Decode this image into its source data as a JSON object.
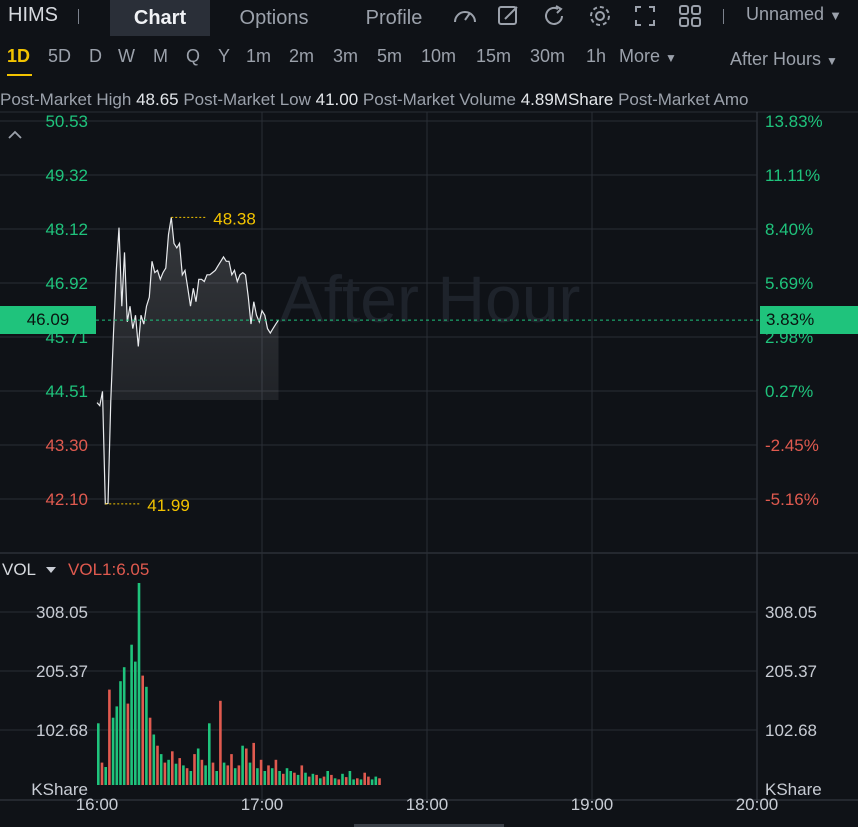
{
  "header": {
    "ticker": "HIMS",
    "tabs": [
      {
        "label": "Chart",
        "active": true
      },
      {
        "label": "Options",
        "active": false
      },
      {
        "label": "Profile",
        "active": false
      }
    ],
    "tool_icons": [
      "gauge-icon",
      "draw-icon",
      "refresh-icon",
      "settings-icon",
      "fullscreen-icon",
      "layout-grid-icon"
    ],
    "layout_name": "Unnamed"
  },
  "intervals": {
    "items": [
      "1D",
      "5D",
      "D",
      "W",
      "M",
      "Q",
      "Y",
      "1m",
      "2m",
      "3m",
      "5m",
      "10m",
      "15m",
      "30m",
      "1h"
    ],
    "active": "1D",
    "more_label": "More",
    "session_label": "After Hours"
  },
  "stats": {
    "high_label": "Post-Market High",
    "high_value": "48.65",
    "low_label": "Post-Market Low",
    "low_value": "41.00",
    "volume_label": "Post-Market Volume",
    "volume_value": "4.89MShare",
    "amount_label": "Post-Market Amo"
  },
  "colors": {
    "up": "#1fc37c",
    "down": "#e05a4f",
    "marker": "#f2c300",
    "line": "#e8eaed",
    "grid": "#2a2e36"
  },
  "chart_data": {
    "type": "line",
    "watermark": "After Hour",
    "x_tick_labels": [
      "16:00",
      "17:00",
      "18:00",
      "19:00",
      "20:00"
    ],
    "price_ticks": [
      "50.53",
      "49.32",
      "48.12",
      "46.92",
      "45.71",
      "44.51",
      "43.30",
      "42.10"
    ],
    "percent_ticks": [
      "13.83%",
      "11.11%",
      "8.40%",
      "5.69%",
      "2.98%",
      "0.27%",
      "-2.45%",
      "-5.16%"
    ],
    "ylim": [
      42.1,
      50.53
    ],
    "reference_price": 44.39,
    "current_price": "46.09",
    "current_percent": "3.83%",
    "high_marker": "48.38",
    "low_marker": "41.99",
    "series": [
      {
        "x_minutes": [
          0,
          1,
          2,
          3,
          4,
          5,
          6,
          7,
          8,
          9,
          10,
          11,
          12,
          13,
          14,
          15,
          16,
          17,
          18,
          19,
          20,
          21,
          22,
          23,
          24,
          25,
          26,
          27,
          28,
          29,
          30,
          31,
          32,
          33,
          34,
          35,
          36,
          37,
          38,
          39,
          40,
          41,
          42,
          43,
          44,
          45,
          46,
          47,
          48,
          49,
          50,
          51,
          52,
          53,
          54,
          55,
          56,
          57,
          58,
          59,
          60,
          61,
          62,
          63,
          64,
          65,
          66,
          67,
          68,
          69,
          70,
          71,
          72,
          73,
          74,
          75,
          76,
          77,
          78,
          79,
          80,
          81,
          82,
          83,
          84,
          85,
          86,
          87,
          88,
          89,
          90,
          91,
          92,
          93,
          94,
          95,
          96,
          97,
          98,
          99,
          100,
          101,
          102
        ],
        "values": [
          44.25,
          44.18,
          44.5,
          41.99,
          42.0,
          44.3,
          45.8,
          47.2,
          48.15,
          46.4,
          47.6,
          46.05,
          46.4,
          45.9,
          46.2,
          45.5,
          46.2,
          46.0,
          46.4,
          46.6,
          47.4,
          47.15,
          47.2,
          47.0,
          47.15,
          47.25,
          48.0,
          48.38,
          47.8,
          47.7,
          47.8,
          47.1,
          47.2,
          46.8,
          46.4,
          46.8,
          46.5,
          47.0,
          47.0,
          46.95,
          47.1,
          47.1,
          47.15,
          47.2,
          47.3,
          47.4,
          47.5,
          47.4,
          47.4,
          47.1,
          47.2,
          46.95,
          47.1,
          47.15,
          47.1,
          46.6,
          46.0,
          46.5,
          46.2,
          46.05,
          46.3,
          46.2,
          45.9,
          45.8,
          45.9,
          46.0,
          46.09
        ]
      }
    ],
    "volume": {
      "label": "VOL",
      "indicator": "VOL1:6.05",
      "unit": "KShare",
      "ticks": [
        "308.05",
        "205.37",
        "102.68"
      ],
      "ylim": [
        0,
        360
      ],
      "bars": [
        [
          110,
          "up"
        ],
        [
          40,
          "down"
        ],
        [
          32,
          "up"
        ],
        [
          170,
          "down"
        ],
        [
          120,
          "up"
        ],
        [
          140,
          "up"
        ],
        [
          185,
          "up"
        ],
        [
          210,
          "up"
        ],
        [
          145,
          "down"
        ],
        [
          250,
          "up"
        ],
        [
          220,
          "up"
        ],
        [
          360,
          "up"
        ],
        [
          195,
          "down"
        ],
        [
          175,
          "up"
        ],
        [
          120,
          "down"
        ],
        [
          90,
          "up"
        ],
        [
          70,
          "down"
        ],
        [
          55,
          "up"
        ],
        [
          40,
          "down"
        ],
        [
          45,
          "up"
        ],
        [
          60,
          "down"
        ],
        [
          38,
          "up"
        ],
        [
          48,
          "down"
        ],
        [
          35,
          "up"
        ],
        [
          30,
          "down"
        ],
        [
          25,
          "up"
        ],
        [
          55,
          "down"
        ],
        [
          65,
          "up"
        ],
        [
          45,
          "down"
        ],
        [
          35,
          "up"
        ],
        [
          110,
          "up"
        ],
        [
          40,
          "down"
        ],
        [
          25,
          "up"
        ],
        [
          150,
          "down"
        ],
        [
          40,
          "up"
        ],
        [
          35,
          "down"
        ],
        [
          55,
          "down"
        ],
        [
          30,
          "up"
        ],
        [
          35,
          "down"
        ],
        [
          70,
          "up"
        ],
        [
          65,
          "down"
        ],
        [
          40,
          "up"
        ],
        [
          75,
          "down"
        ],
        [
          30,
          "up"
        ],
        [
          45,
          "down"
        ],
        [
          25,
          "up"
        ],
        [
          35,
          "down"
        ],
        [
          30,
          "up"
        ],
        [
          45,
          "down"
        ],
        [
          25,
          "up"
        ],
        [
          20,
          "down"
        ],
        [
          30,
          "up"
        ],
        [
          25,
          "up"
        ],
        [
          22,
          "down"
        ],
        [
          18,
          "up"
        ],
        [
          35,
          "down"
        ],
        [
          22,
          "up"
        ],
        [
          15,
          "down"
        ],
        [
          20,
          "up"
        ],
        [
          18,
          "down"
        ],
        [
          12,
          "up"
        ],
        [
          15,
          "down"
        ],
        [
          25,
          "up"
        ],
        [
          18,
          "down"
        ],
        [
          12,
          "up"
        ],
        [
          10,
          "down"
        ],
        [
          20,
          "up"
        ],
        [
          14,
          "down"
        ],
        [
          25,
          "up"
        ],
        [
          10,
          "up"
        ],
        [
          12,
          "down"
        ],
        [
          10,
          "up"
        ],
        [
          22,
          "down"
        ],
        [
          15,
          "down"
        ],
        [
          10,
          "up"
        ],
        [
          15,
          "up"
        ],
        [
          12,
          "down"
        ]
      ]
    }
  }
}
